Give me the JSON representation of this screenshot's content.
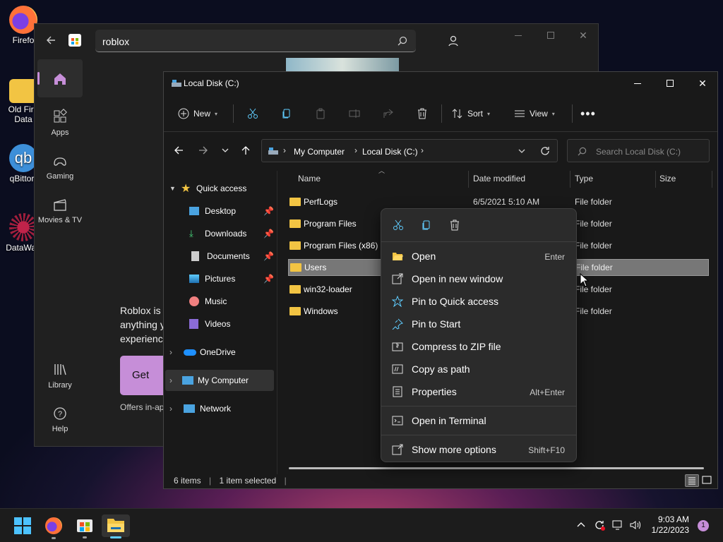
{
  "desktop": {
    "icons": [
      {
        "label": "Firefo"
      },
      {
        "label": "Old Fire\nData"
      },
      {
        "label": "qBittorr"
      },
      {
        "label": "DataWag"
      }
    ]
  },
  "store": {
    "search_value": "roblox",
    "nav": [
      {
        "label": ""
      },
      {
        "label": "Apps"
      },
      {
        "label": "Gaming"
      },
      {
        "label": "Movies & TV"
      },
      {
        "label": "Library"
      },
      {
        "label": "Help"
      }
    ],
    "desc_lines": [
      "Roblox is t",
      "anything y",
      "experienc"
    ],
    "get_label": "Get",
    "offers": "Offers in-ap"
  },
  "explorer": {
    "title": "Local Disk (C:)",
    "toolbar": {
      "new": "New",
      "sort": "Sort",
      "view": "View"
    },
    "breadcrumb": [
      "My Computer",
      "Local Disk (C:)"
    ],
    "search_placeholder": "Search Local Disk (C:)",
    "nav": {
      "quick_access": "Quick access",
      "quick_items": [
        "Desktop",
        "Downloads",
        "Documents",
        "Pictures",
        "Music",
        "Videos"
      ],
      "onedrive": "OneDrive",
      "my_computer": "My Computer",
      "network": "Network"
    },
    "columns": {
      "name": "Name",
      "date": "Date modified",
      "type": "Type",
      "size": "Size"
    },
    "rows": [
      {
        "name": "PerfLogs",
        "date": "6/5/2021 5:10 AM",
        "type": "File folder"
      },
      {
        "name": "Program Files",
        "date": "",
        "type": "File folder"
      },
      {
        "name": "Program Files (x86)",
        "date": "",
        "type": "File folder"
      },
      {
        "name": "Users",
        "date": "",
        "type": "File folder",
        "selected": true
      },
      {
        "name": "win32-loader",
        "date": "",
        "type": "File folder"
      },
      {
        "name": "Windows",
        "date": "",
        "type": "File folder"
      }
    ],
    "status": {
      "items": "6 items",
      "selected": "1 item selected"
    }
  },
  "context_menu": {
    "items": [
      {
        "label": "Open",
        "shortcut": "Enter",
        "icon": "folder-open-icon"
      },
      {
        "label": "Open in new window",
        "shortcut": "",
        "icon": "new-window-icon"
      },
      {
        "label": "Pin to Quick access",
        "shortcut": "",
        "icon": "star-icon"
      },
      {
        "label": "Pin to Start",
        "shortcut": "",
        "icon": "pin-icon"
      },
      {
        "label": "Compress to ZIP file",
        "shortcut": "",
        "icon": "zip-icon"
      },
      {
        "label": "Copy as path",
        "shortcut": "",
        "icon": "path-icon"
      },
      {
        "label": "Properties",
        "shortcut": "Alt+Enter",
        "icon": "properties-icon"
      },
      {
        "label": "Open in Terminal",
        "shortcut": "",
        "icon": "terminal-icon"
      },
      {
        "label": "Show more options",
        "shortcut": "Shift+F10",
        "icon": "more-options-icon"
      }
    ]
  },
  "taskbar": {
    "time": "9:03 AM",
    "date": "1/22/2023",
    "notification_count": "1"
  },
  "colors": {
    "accent": "#60cdff",
    "folder": "#f2c443",
    "store_pink": "#c68ed8"
  }
}
